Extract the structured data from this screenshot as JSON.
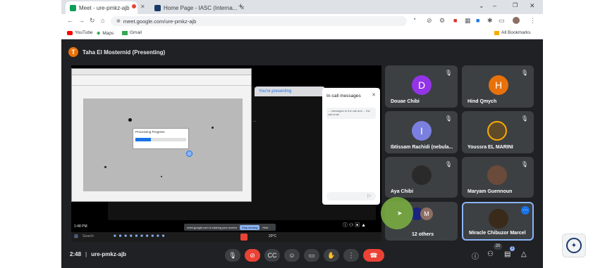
{
  "browser": {
    "tabs": [
      {
        "label": "Meet - ure-pmkz-ajb",
        "color": "#0f9d58"
      },
      {
        "label": "Home Page - IASC (Interna...",
        "color": "#1a3a6b"
      }
    ],
    "new_tab": "+",
    "url": "meet.google.com/ure-pmkz-ajb",
    "bookmarks": [
      "YouTube",
      "Maps",
      "Gmail"
    ],
    "all_bookmarks": "All Bookmarks"
  },
  "meet": {
    "presenter_initial": "T",
    "presenter_label": "Taha El Mosternid (Presenting)",
    "share": {
      "presenting_tab": "You're presenting",
      "chat_title": "In-call messages",
      "chat_note": "... messages to the call and ... the call ends",
      "chat_text": "...",
      "dialog_title": "Processing Progress",
      "clock": "1:48 PM",
      "taskbar_search": "Search",
      "sharing_note": "meet.google.com is sharing your screen",
      "stop_sharing": "Stop sharing",
      "hide": "Hide",
      "sys_time": "20°C"
    },
    "participants": [
      {
        "name": "Douae Chibi",
        "initial": "D",
        "color": "#9334e6"
      },
      {
        "name": "Hind Qmych",
        "initial": "H",
        "color": "#e8710a"
      },
      {
        "name": "Ibtissam Rachidi (nebula...",
        "initial": "I",
        "color": "#7b7fe0"
      },
      {
        "name": "Youssra EL MARINI",
        "initial": "",
        "color": "#5f4a2a"
      },
      {
        "name": "Aya Chibi",
        "initial": "",
        "color": "#2a2a2a"
      },
      {
        "name": "Maryam Guennoun",
        "initial": "",
        "color": "#6a4a3a"
      },
      {
        "name": "12 others",
        "initial": "M",
        "color": "#8d6e63"
      },
      {
        "name": "Miracle Chibuzor Marcel",
        "initial": "",
        "color": "#3a2a1a"
      }
    ],
    "meeting_time": "2:48",
    "meeting_code": "ure-pmkz-ajb",
    "participants_count": "20",
    "hand_raised_count": "1"
  }
}
